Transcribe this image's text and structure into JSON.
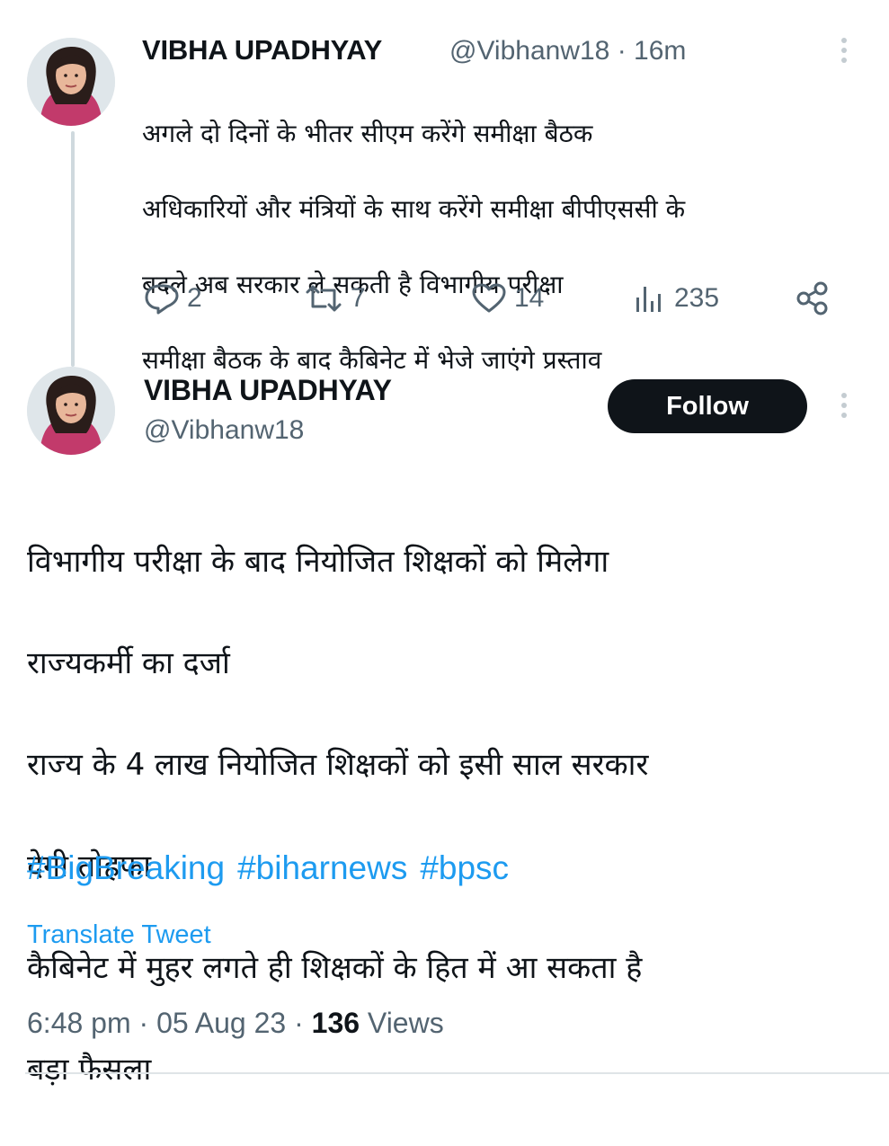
{
  "tweet1": {
    "author_name": "VIBHA UPADHYAY",
    "handle": "@Vibhanw18",
    "separator": "·",
    "time": "16m",
    "lines": [
      "अगले दो दिनों के भीतर सीएम करेंगे समीक्षा बैठक",
      " अधिकारियों और मंत्रियों के साथ करेंगे समीक्षा  बीपीएससी के",
      "बदले अब सरकार ले सकती है विभागीय परीक्षा",
      " समीक्षा बैठक के बाद कैबिनेट में भेजे जाएंगे प्रस्ताव"
    ],
    "actions": {
      "replies": "2",
      "retweets": "7",
      "likes": "14",
      "views": "235"
    }
  },
  "tweet2": {
    "author_name": "VIBHA UPADHYAY",
    "handle": "@Vibhanw18",
    "follow_label": "Follow",
    "lines": [
      "विभागीय परीक्षा के बाद नियोजित शिक्षकों को  मिलेगा",
      "राज्यकर्मी का दर्जा",
      "राज्य के 4 लाख नियोजित शिक्षकों को इसी साल सरकार",
      "देगी तोहफा",
      " कैबिनेट में मुहर लगते ही शिक्षकों के हित में आ सकता है",
      "बड़ा फैसला"
    ],
    "hashtags": [
      "#BigBreaking",
      "#biharnews",
      "#bpsc"
    ],
    "translate_label": "Translate Tweet",
    "meta": {
      "time": "6:48 pm",
      "dot1": "·",
      "date": "05 Aug 23",
      "dot2": "·",
      "views_count": "136",
      "views_label": "Views"
    }
  },
  "colors": {
    "text": "#0f1419",
    "muted": "#536471",
    "link": "#1d9bf0",
    "thread_line": "#cfd9de",
    "button_bg": "#0f1419"
  }
}
